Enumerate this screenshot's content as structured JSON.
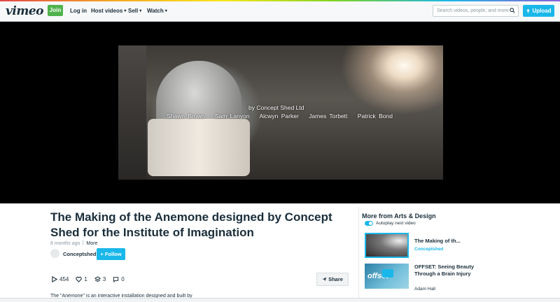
{
  "header": {
    "logo": "vimeo",
    "join_label": "Join",
    "nav": [
      {
        "label": "Log in",
        "has_menu": false
      },
      {
        "label": "Host videos",
        "has_menu": true
      },
      {
        "label": "Sell",
        "has_menu": true
      },
      {
        "label": "Watch",
        "has_menu": true
      }
    ],
    "search_placeholder": "Search videos, people, and more",
    "upload_label": "Upload"
  },
  "player": {
    "credit_line": "by Concept Shed Ltd",
    "credit_names": [
      "Shawn Brown",
      "Sam Lanyon",
      "Alcwyn Parker",
      "James Torbett",
      "Patrick Bond"
    ]
  },
  "video": {
    "title": "The Making of the Anemone designed by Concept Shed for the Institute of Imagination",
    "age": "8 months ago",
    "more_label": "More",
    "channel": "Conceptshed",
    "follow_label": "+ Follow",
    "stats": {
      "plays": "454",
      "likes": "1",
      "collections": "3",
      "comments": "0"
    },
    "share_label": "Share",
    "description": "The \"Anemone\" is an interactive installation designed and built by"
  },
  "sidebar": {
    "title": "More from Arts & Design",
    "autoplay_label": "Autoplay next video",
    "videos": [
      {
        "title": "The Making of th...",
        "author": "Conceptshed"
      },
      {
        "title": "OFFSET: Seeing Beauty Through a Brain Injury",
        "author": "Adam Hall"
      }
    ]
  },
  "colors": {
    "accent": "#1ab7ea",
    "join": "#4fb34d",
    "text": "#1a2e3b"
  }
}
